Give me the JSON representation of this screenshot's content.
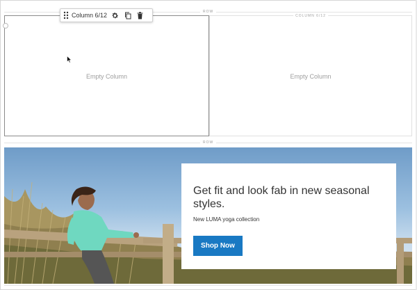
{
  "rows": {
    "top_label": "ROW",
    "middle_label": "ROW"
  },
  "columns": {
    "left": {
      "empty_text": "Empty Column"
    },
    "right": {
      "empty_text": "Empty Column",
      "label": "COLUMN 6/12"
    }
  },
  "toolbar": {
    "drag_icon": "drag-handle-icon",
    "label": "Column 6/12",
    "settings_icon": "gear-icon",
    "duplicate_icon": "copy-icon",
    "delete_icon": "trash-icon"
  },
  "banner": {
    "title": "Get fit and look fab in new seasonal styles.",
    "subtitle": "New LUMA yoga collection",
    "button_label": "Shop Now"
  },
  "colors": {
    "button": "#1979c3",
    "border_active": "#8a8a8a"
  }
}
